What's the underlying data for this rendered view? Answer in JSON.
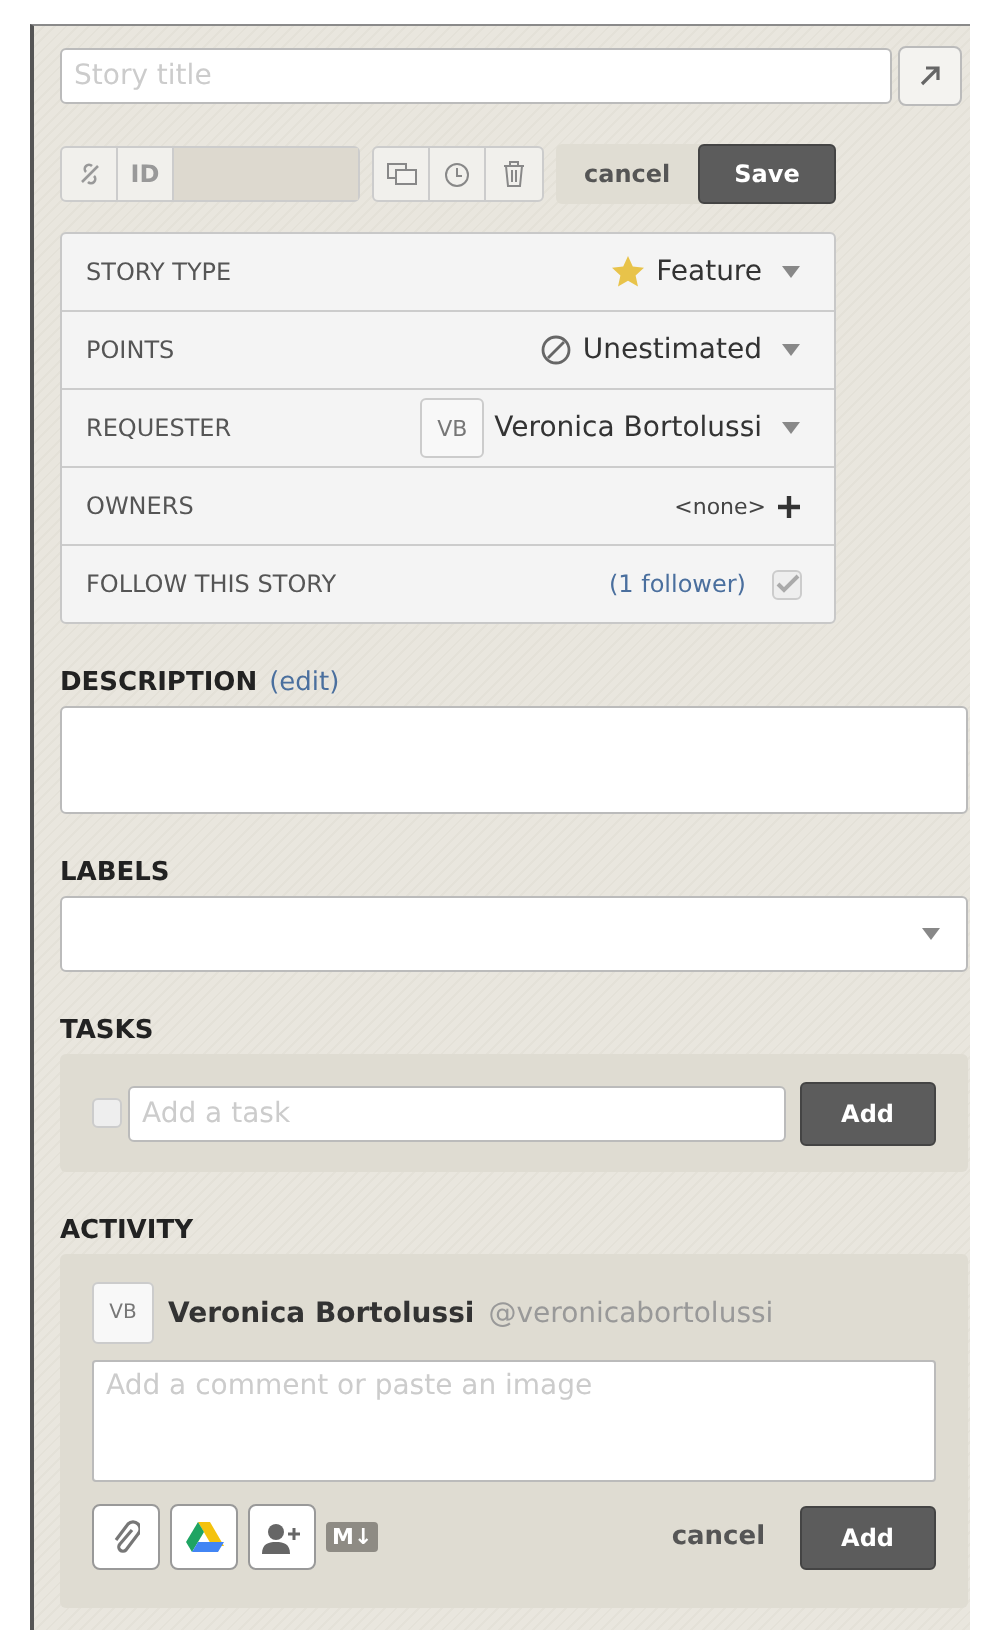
{
  "title_field": {
    "placeholder": "Story title"
  },
  "toolbar": {
    "id_label": "ID",
    "cancel": "cancel",
    "save": "Save"
  },
  "details": [
    {
      "kind": "type",
      "label": "STORY TYPE",
      "value": "Feature"
    },
    {
      "kind": "points",
      "label": "POINTS",
      "value": "Unestimated"
    },
    {
      "kind": "person",
      "label": "REQUESTER",
      "initials": "VB",
      "value": "Veronica Bortolussi"
    },
    {
      "kind": "add",
      "label": "OWNERS",
      "value": "<none>"
    },
    {
      "kind": "follow",
      "label": "FOLLOW THIS STORY",
      "value": "(1 follower)",
      "checked": true
    }
  ],
  "description": {
    "heading": "DESCRIPTION",
    "link": "(edit)"
  },
  "labels": {
    "heading": "LABELS"
  },
  "tasks": {
    "heading": "TASKS",
    "checked": false,
    "placeholder": "Add a task",
    "button": "Add"
  },
  "activity": {
    "heading": "ACTIVITY",
    "initials": "VB",
    "name": "Veronica Bortolussi",
    "handle": "@veronicabortolussi",
    "placeholder": "Add a comment or paste an image",
    "markdown": "M↓",
    "cancel": "cancel",
    "button": "Add"
  }
}
